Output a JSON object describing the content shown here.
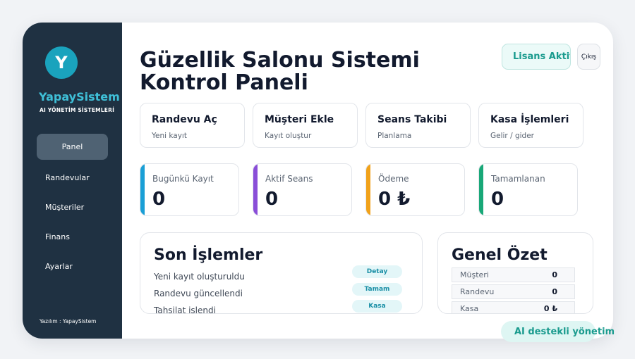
{
  "sidebar": {
    "logo_letter": "Y",
    "brand": "YapaySistem",
    "brand_sub": "AI YÖNETİM SİSTEMLERİ",
    "nav": [
      {
        "label": "Panel",
        "active": true
      },
      {
        "label": "Randevular"
      },
      {
        "label": "Müşteriler"
      },
      {
        "label": "Finans"
      },
      {
        "label": "Ayarlar"
      }
    ],
    "footer": "Yazılım : YapaySistem"
  },
  "header": {
    "title_line1": "Güzellik Salonu Sistemi",
    "title_line2": "Kontrol Paneli",
    "license_label": "Lisans Aktif",
    "exit_label": "Çıkış"
  },
  "actions": [
    {
      "title": "Randevu Aç",
      "subtitle": "Yeni kayıt"
    },
    {
      "title": "Müşteri Ekle",
      "subtitle": "Kayıt oluştur"
    },
    {
      "title": "Seans Takibi",
      "subtitle": "Planlama"
    },
    {
      "title": "Kasa İşlemleri",
      "subtitle": "Gelir / gider"
    }
  ],
  "stats": [
    {
      "label": "Bugünkü Kayıt",
      "value": "0",
      "color": "#1a9fd6"
    },
    {
      "label": "Aktif Seans",
      "value": "0",
      "color": "#8a4ed8"
    },
    {
      "label": "Ödeme",
      "value": "0 ₺",
      "color": "#f1a21a"
    },
    {
      "label": "Tamamlanan",
      "value": "0",
      "color": "#19a878"
    }
  ],
  "transactions": {
    "title": "Son İşlemler",
    "rows": [
      {
        "text": "Yeni kayıt oluşturuldu",
        "badge": "Detay"
      },
      {
        "text": "Randevu güncellendi",
        "badge": "Tamam"
      },
      {
        "text": "Tahsilat işlendi",
        "badge": "Kasa"
      }
    ]
  },
  "summary": {
    "title": "Genel Özet",
    "rows": [
      {
        "label": "Müşteri",
        "value": "0"
      },
      {
        "label": "Randevu",
        "value": "0"
      },
      {
        "label": "Kasa",
        "value": "0 ₺"
      }
    ]
  },
  "ai_pill": "AI destekli yönetim"
}
